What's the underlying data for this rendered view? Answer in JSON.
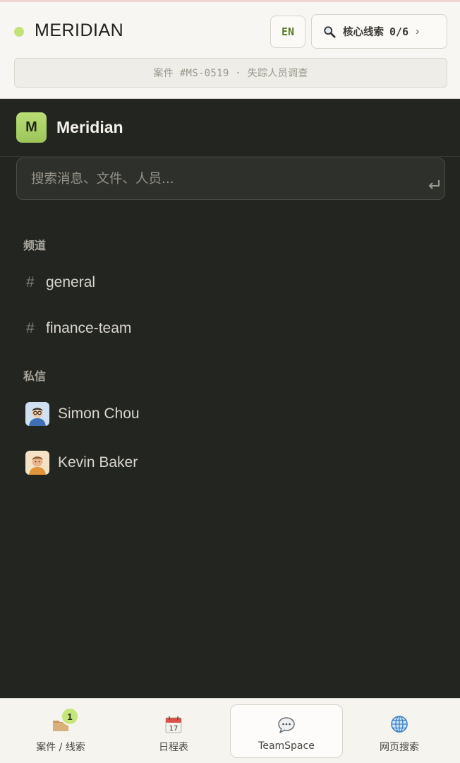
{
  "header": {
    "brand": "MERIDIAN",
    "lang_button": "EN",
    "clues_label": "核心线索",
    "clues_count": "0/6",
    "clues_chevron": "›",
    "case_line": "案件 #MS-0519 · 失踪人员调查"
  },
  "workspace": {
    "logo_letter": "M",
    "name": "Meridian",
    "search_placeholder": "搜索消息、文件、人员..."
  },
  "sidebar": {
    "channels_heading": "频道",
    "channels": [
      {
        "hash": "#",
        "label": "general"
      },
      {
        "hash": "#",
        "label": "finance-team"
      }
    ],
    "dms_heading": "私信",
    "dms": [
      {
        "label": "Simon Chou",
        "avatar": "man-glasses-avatar"
      },
      {
        "label": "Kevin Baker",
        "avatar": "man-avatar"
      }
    ]
  },
  "bottom_nav": {
    "items": [
      {
        "label": "案件 / 线索",
        "icon": "folder-icon",
        "badge": "1"
      },
      {
        "label": "日程表",
        "icon": "calendar-icon",
        "calendar_day": "17"
      },
      {
        "label": "TeamSpace",
        "icon": "chat-icon",
        "active": true
      },
      {
        "label": "网页搜索",
        "icon": "globe-icon"
      }
    ]
  },
  "colors": {
    "accent": "#c3e27a",
    "panel_bg": "#232520",
    "header_bg": "#f8f6f2"
  }
}
